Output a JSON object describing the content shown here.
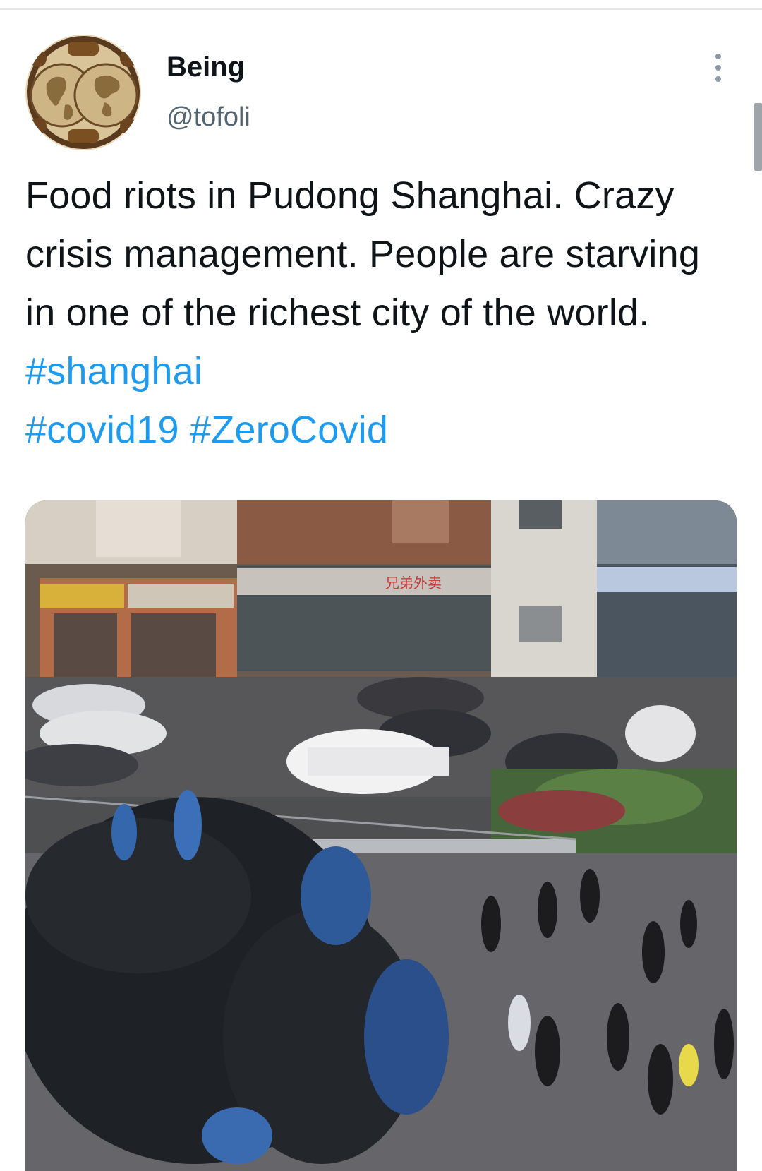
{
  "tweet": {
    "author": {
      "display_name": "Being",
      "handle": "@tofoli"
    },
    "text_plain": "Food riots in Pudong Shanghai. Crazy crisis management. People are starving in one of the richest city of the world. ",
    "hashtags": [
      "#shanghai",
      "#covid19",
      "#ZeroCovid"
    ],
    "more_icon": "more-vertical-icon",
    "media": {
      "type": "video-thumbnail",
      "sign_text": "兄弟外卖"
    }
  },
  "colors": {
    "text": "#0f1419",
    "secondary": "#536471",
    "link": "#1d9bf0"
  }
}
